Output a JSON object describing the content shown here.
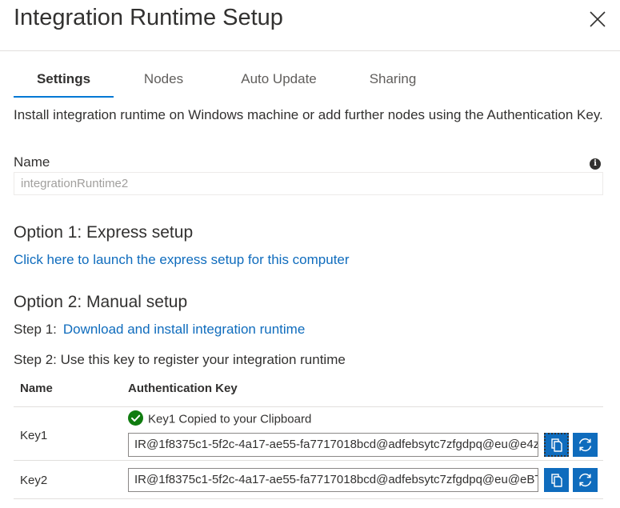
{
  "header": {
    "title": "Integration Runtime Setup",
    "close_icon": "close-icon"
  },
  "tabs": [
    {
      "label": "Settings",
      "active": true
    },
    {
      "label": "Nodes",
      "active": false
    },
    {
      "label": "Auto Update",
      "active": false
    },
    {
      "label": "Sharing",
      "active": false
    }
  ],
  "description": "Install integration runtime on Windows machine or add further nodes using the Authentication Key.",
  "name_field": {
    "label": "Name",
    "value": "integrationRuntime2",
    "info_icon": "info-icon"
  },
  "option1": {
    "heading": "Option 1: Express setup",
    "link": "Click here to launch the express setup for this computer"
  },
  "option2": {
    "heading": "Option 2: Manual setup",
    "step1_prefix": "Step 1:",
    "step1_link": "Download and install integration runtime",
    "step2": "Step 2: Use this key to register your integration runtime"
  },
  "keys_table": {
    "columns": [
      "Name",
      "Authentication Key"
    ],
    "copied_message": "Key1 Copied to your Clipboard",
    "rows": [
      {
        "name": "Key1",
        "value": "IR@1f8375c1-5f2c-4a17-ae55-fa7717018bcd@adfebsytc7zfgdpq@eu@e4z"
      },
      {
        "name": "Key2",
        "value": "IR@1f8375c1-5f2c-4a17-ae55-fa7717018bcd@adfebsytc7zfgdpq@eu@eBT"
      }
    ]
  },
  "colors": {
    "accent": "#0f6cbd",
    "success": "#107c10",
    "tab_underline": "#0078d4"
  }
}
